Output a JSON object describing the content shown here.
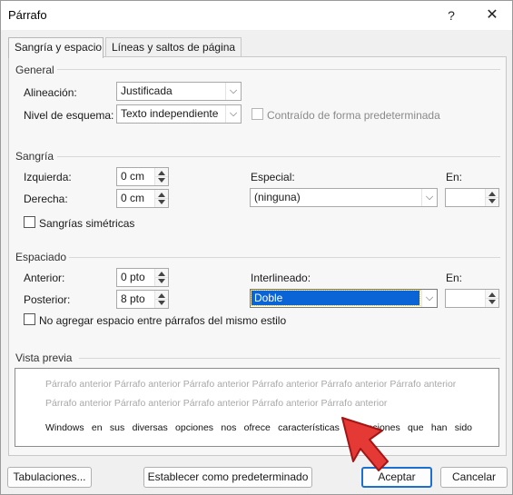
{
  "window": {
    "title": "Párrafo",
    "help_label": "?",
    "close_label": "✕"
  },
  "tabs": [
    {
      "label": "Sangría y espacio",
      "active": true
    },
    {
      "label": "Líneas y saltos de página",
      "active": false
    }
  ],
  "general": {
    "section_label": "General",
    "alignment_label": "Alineación:",
    "alignment_value": "Justificada",
    "outline_label": "Nivel de esquema:",
    "outline_value": "Texto independiente",
    "collapsed_label": "Contraído de forma predeterminada"
  },
  "indent": {
    "section_label": "Sangría",
    "left_label": "Izquierda:",
    "left_value": "0 cm",
    "right_label": "Derecha:",
    "right_value": "0 cm",
    "special_label": "Especial:",
    "special_value": "(ninguna)",
    "by_label": "En:",
    "by_value": "",
    "mirror_label": "Sangrías simétricas"
  },
  "spacing": {
    "section_label": "Espaciado",
    "before_label": "Anterior:",
    "before_value": "0 pto",
    "after_label": "Posterior:",
    "after_value": "8 pto",
    "line_label": "Interlineado:",
    "line_value": "Doble",
    "at_label": "En:",
    "at_value": "",
    "no_space_label": "No agregar espacio entre párrafos del mismo estilo"
  },
  "preview": {
    "section_label": "Vista previa",
    "prev_line_1": "Párrafo anterior Párrafo anterior Párrafo anterior Párrafo anterior Párrafo anterior Párrafo anterior",
    "prev_line_2": "Párrafo anterior Párrafo anterior Párrafo anterior Párrafo anterior Párrafo anterior",
    "sample_text": "Windows en sus diversas opciones nos ofrece características y funciones que han sido"
  },
  "buttons": {
    "tabs_label": "Tabulaciones...",
    "default_label": "Establecer como predeterminado",
    "ok_label": "Aceptar",
    "cancel_label": "Cancelar"
  },
  "colors": {
    "accent": "#1a6fd0",
    "selection": "#0a64d6",
    "cursor_arrow": "#e53935"
  }
}
